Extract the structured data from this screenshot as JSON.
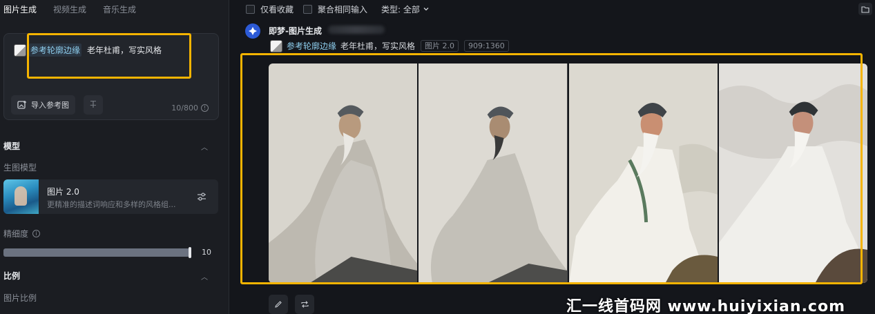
{
  "left_panel": {
    "tabs": [
      {
        "label": "图片生成",
        "active": true
      },
      {
        "label": "视频生成",
        "active": false
      },
      {
        "label": "音乐生成",
        "active": false
      }
    ],
    "prompt": {
      "ref_tag": "参考轮廓边缘",
      "text": "老年杜甫，写实风格",
      "import_button": "导入参考图",
      "text_button_icon": "text-format-icon",
      "counter": "10/800"
    },
    "model_section": {
      "title": "模型",
      "sub_label": "生图模型",
      "model_name": "图片 2.0",
      "model_desc": "更精准的描述词响应和多样的风格组..."
    },
    "detail": {
      "label": "精细度",
      "value": "10",
      "fraction": 1.0
    },
    "ratio_section": {
      "title": "比例",
      "sub_label": "图片比例"
    }
  },
  "toolbar": {
    "only_favorites": "仅看收藏",
    "merge_inputs": "聚合相同输入",
    "type_filter": "类型: 全部"
  },
  "generation": {
    "title": "即梦-图片生成",
    "ref_tag": "参考轮廓边缘",
    "prompt": "老年杜甫，写实风格",
    "model_tag": "图片 2.0",
    "size_tag": "909:1360",
    "images": [
      {
        "style": "ink-grey"
      },
      {
        "style": "ink-grey-soft"
      },
      {
        "style": "painted-warm"
      },
      {
        "style": "painted-cool"
      }
    ]
  },
  "watermark": "汇一线首码网 www.huiyixian.com",
  "colors": {
    "highlight": "#f6b400",
    "accent": "#2c5ad6",
    "ref_tag": "#8fd0f0"
  }
}
